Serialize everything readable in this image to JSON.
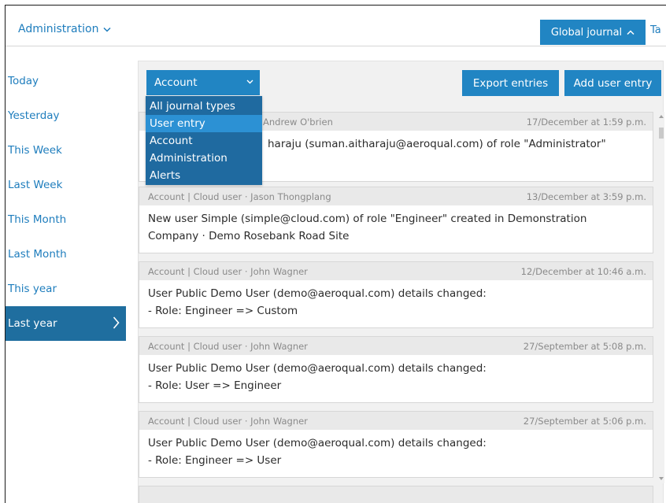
{
  "header": {
    "admin_menu_label": "Administration",
    "journal_button_label": "Global journal",
    "next_tab_label": "Ta"
  },
  "sidebar": {
    "items": [
      {
        "label": "Today",
        "active": false
      },
      {
        "label": "Yesterday",
        "active": false
      },
      {
        "label": "This Week",
        "active": false
      },
      {
        "label": "Last Week",
        "active": false
      },
      {
        "label": "This Month",
        "active": false
      },
      {
        "label": "Last Month",
        "active": false
      },
      {
        "label": "This year",
        "active": false
      },
      {
        "label": "Last year",
        "active": true
      }
    ]
  },
  "toolbar": {
    "journal_type_selected": "Account",
    "journal_type_options": [
      "All journal types",
      "User entry",
      "Account",
      "Administration",
      "Alerts"
    ],
    "hovered_option": "User entry",
    "export_label": "Export entries",
    "add_label": "Add user entry"
  },
  "entries": [
    {
      "header": "Andrew O'brien",
      "timestamp": "17/December at 1:59 p.m.",
      "lines": [
        "haraju (suman.aitharaju@aeroqual.com) of role \"Administrator\"",
        ""
      ]
    },
    {
      "header": "Account | Cloud user · Jason Thongplang",
      "timestamp": "13/December at 3:59 p.m.",
      "lines": [
        "New user Simple (simple@cloud.com) of role \"Engineer\" created in Demonstration",
        "Company · Demo Rosebank Road Site"
      ]
    },
    {
      "header": "Account | Cloud user · John Wagner",
      "timestamp": "12/December at 10:46 a.m.",
      "lines": [
        "User Public Demo User (demo@aeroqual.com) details changed:",
        "- Role: Engineer => Custom"
      ]
    },
    {
      "header": "Account | Cloud user · John Wagner",
      "timestamp": "27/September at 5:08 p.m.",
      "lines": [
        "User Public Demo User (demo@aeroqual.com) details changed:",
        "- Role: User => Engineer"
      ]
    },
    {
      "header": "Account | Cloud user · John Wagner",
      "timestamp": "27/September at 5:06 p.m.",
      "lines": [
        "User Public Demo User (demo@aeroqual.com) details changed:",
        "- Role: Engineer => User"
      ]
    }
  ],
  "colors": {
    "accent": "#2185c3",
    "active_sidebar": "#1f6e9f",
    "dropdown_bg": "#1f6aa0",
    "dropdown_hover": "#2c91d4",
    "link": "#1e7dbd",
    "entry_header_bg": "#e9e9e9"
  },
  "icons": {
    "admin_menu": "chevron-down-icon",
    "journal_button": "chevron-up-icon",
    "select": "chevron-down-icon",
    "active_sidebar": "chevron-right-icon",
    "scroll_up": "arrow-up-icon",
    "scroll_down": "arrow-down-icon"
  }
}
